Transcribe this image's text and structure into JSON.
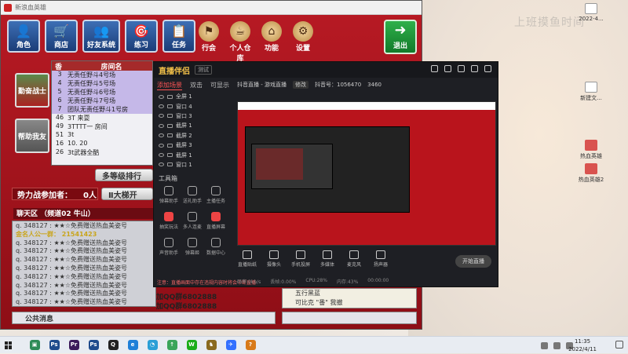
{
  "game": {
    "window_title": "新浪血英雄",
    "nav": [
      {
        "label": "角色",
        "glyph": "👤"
      },
      {
        "label": "商店",
        "glyph": "🛒"
      },
      {
        "label": "好友系统",
        "glyph": "👥"
      },
      {
        "label": "练习",
        "glyph": "🎯"
      },
      {
        "label": "任务",
        "glyph": "📋"
      }
    ],
    "round_icons": [
      {
        "label": "行会",
        "glyph": "⚑"
      },
      {
        "label": "个人仓库",
        "glyph": "☕"
      },
      {
        "label": "功能",
        "glyph": "⌂"
      },
      {
        "label": "设置",
        "glyph": "⚙"
      }
    ],
    "exit_label": "退出",
    "badges": [
      "勤奋战士",
      "帮助我友"
    ],
    "room_table": {
      "headers": [
        "香",
        "房间名"
      ],
      "rows": [
        {
          "n": "3",
          "name": "无责任野斗4号场",
          "hl": true
        },
        {
          "n": "4",
          "name": "无责任野斗5号场",
          "hl": true
        },
        {
          "n": "5",
          "name": "无责任野斗6号场",
          "hl": true
        },
        {
          "n": "6",
          "name": "无责任野斗7号场",
          "hl": true
        },
        {
          "n": "7",
          "name": "团队无责任野斗1号房",
          "hl": true
        },
        {
          "n": "46",
          "name": "3T 来耍",
          "hl": false
        },
        {
          "n": "49",
          "name": "3TTTT一 房间",
          "hl": false
        },
        {
          "n": "51",
          "name": "3t",
          "hl": false
        },
        {
          "n": "16",
          "name": "10. 20",
          "hl": false
        },
        {
          "n": "26",
          "name": "3t武器全酷",
          "hl": false
        }
      ]
    },
    "side_btn_1": "多等级排行",
    "side_btn_2": "Ⅱ大梯开",
    "fight_label": "势力战参加者：",
    "fight_value": "0人",
    "chat_head": "聊天区 （频道02  牛山）",
    "chat_lines": [
      {
        "text": "q. 348127 : ★★☆免费赠送热血美姿号",
        "yellow": false
      },
      {
        "text": "金名人公一群：  21541423",
        "yellow": true
      },
      {
        "text": "q. 348127 : ★★☆免费赠送热血美姿号",
        "yellow": false
      },
      {
        "text": "q. 348127 : ★★☆免费赠送热血美姿号",
        "yellow": false
      },
      {
        "text": "q. 348127 : ★★☆免费赠送热血美姿号",
        "yellow": false
      },
      {
        "text": "q. 348127 : ★★☆免费赠送热血美姿号",
        "yellow": false
      },
      {
        "text": "q. 348127 : ★★☆免费赠送热血美姿号",
        "yellow": false
      },
      {
        "text": "q. 348127 : ★★☆免费赠送热血美姿号",
        "yellow": false
      },
      {
        "text": "q. 348127 : ★★☆免费赠送热血美姿号",
        "yellow": false
      },
      {
        "text": "q. 348127 : ★★☆免费赠送热血美姿号",
        "yellow": false
      }
    ],
    "qq_lines": [
      "加QQ群6802888",
      "加QQ群6802888"
    ],
    "public_msg": "公共消息",
    "mini_list": [
      "五行黑蓝",
      "可比克 \"番\" 我撤"
    ]
  },
  "stream": {
    "logo": "直播伴侣",
    "version": "测试",
    "tabs": [
      "添加场景",
      "双击",
      "可显示"
    ],
    "scenes": [
      "全屏 1",
      "窗口 4",
      "窗口 3",
      "截屏 1",
      "截屏 2",
      "截屏 3",
      "截屏 1",
      "窗口 1"
    ],
    "tools_head": "工具箱",
    "tools": [
      {
        "label": "弹幕助手",
        "red": false
      },
      {
        "label": "送礼助手",
        "red": false
      },
      {
        "label": "主播任务",
        "red": false
      },
      {
        "label": "抽奖玩法",
        "red": true
      },
      {
        "label": "多人连麦",
        "red": false
      },
      {
        "label": "直播屏幕",
        "red": true
      },
      {
        "label": "声音助手",
        "red": false
      },
      {
        "label": "弹幕姬",
        "red": false
      },
      {
        "label": "数据中心",
        "red": false
      }
    ],
    "warn": "注意：直播画面中存在违规内容时将会中断直播",
    "live_title": "抖音直播 - 游戏直播",
    "live_badge": "修改",
    "live_info": "抖音号：1056470",
    "live_count": "3460",
    "bottom_tools": [
      "直播贴纸",
      "摄像头",
      "手机投屏",
      "多媒体",
      "麦克风",
      "扬声器"
    ],
    "start_label": "开始直播",
    "status": [
      "码率:0kb/s",
      "丢帧:0.00%",
      "CPU:28%",
      "内存:43%",
      "00:00:00"
    ]
  },
  "desktop": {
    "watermark": "上班摸鱼时间",
    "icons": [
      {
        "label": "2022-4...",
        "color": "#ffffff"
      },
      {
        "label": "新建文...",
        "color": "#ffffff"
      },
      {
        "label": "热血英雄",
        "color": "#d9534f"
      },
      {
        "label": "热血英雄2",
        "color": "#d9534f"
      }
    ]
  },
  "taskbar": {
    "apps": [
      {
        "name": "file-explorer-icon",
        "color": "#2e8b57",
        "glyph": "▣"
      },
      {
        "name": "photoshop-icon",
        "color": "#1f4b8c",
        "glyph": "Ps"
      },
      {
        "name": "premiere-icon",
        "color": "#3b1a5a",
        "glyph": "Pr"
      },
      {
        "name": "ps2-icon",
        "color": "#1f4b8c",
        "glyph": "Ps"
      },
      {
        "name": "qq-icon",
        "color": "#222222",
        "glyph": "Q"
      },
      {
        "name": "edge-icon",
        "color": "#1e7fd8",
        "glyph": "e"
      },
      {
        "name": "browser-icon",
        "color": "#2a9fd6",
        "glyph": "◔"
      },
      {
        "name": "upload-icon",
        "color": "#3aa55a",
        "glyph": "↑"
      },
      {
        "name": "wechat-icon",
        "color": "#1aad19",
        "glyph": "W"
      },
      {
        "name": "game-icon",
        "color": "#8a6a20",
        "glyph": "♞"
      },
      {
        "name": "feishu-icon",
        "color": "#3370ff",
        "glyph": "✈"
      },
      {
        "name": "app-icon",
        "color": "#d87a1a",
        "glyph": "?"
      }
    ],
    "time": "11:35",
    "date": "2022/4/11"
  }
}
